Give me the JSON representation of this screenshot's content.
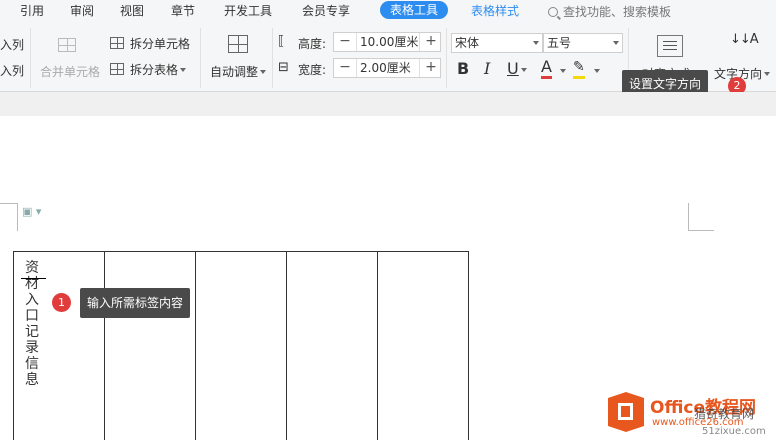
{
  "tabs": [
    "引用",
    "审阅",
    "视图",
    "章节",
    "开发工具",
    "会员专享",
    "表格工具",
    "表格样式"
  ],
  "active_tab": "表格工具",
  "search": {
    "placeholder": "查找功能、搜索模板"
  },
  "ribbon": {
    "insert_col_left": "入列",
    "insert_col_right": "入列",
    "merge_cells": "合并单元格",
    "split_cells": "拆分单元格",
    "split_table": "拆分表格",
    "auto_adjust": "自动调整",
    "height_label": "高度:",
    "height_value": "10.00厘米",
    "width_label": "宽度:",
    "width_value": "2.00厘米",
    "font_name": "宋体",
    "font_size": "五号",
    "bold": "B",
    "italic": "I",
    "underline": "U",
    "font_color": "A",
    "align": "对齐方式",
    "text_direction": "文字方向",
    "minus": "−",
    "plus": "+"
  },
  "tooltip_text_direction": {
    "text": "设置文字方向",
    "badge": "2"
  },
  "tooltip_input": {
    "text": "输入所需标签内容",
    "badge": "1"
  },
  "cell_text": "资材入口记录信息",
  "watermark": {
    "brand": "Office教程网",
    "url": "www.office26.com",
    "sub": "51zixue.com",
    "overlay": "猎奇教育网"
  },
  "colors": {
    "accent": "#2d8cf0",
    "badge": "#e03c3c",
    "tooltip": "#4a4a4a",
    "office_orange": "#e8571e"
  }
}
